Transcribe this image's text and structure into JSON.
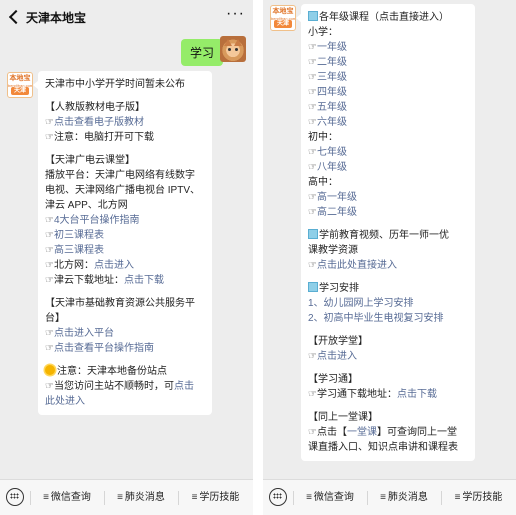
{
  "header": {
    "title": "天津本地宝",
    "more_icon": "more-dots-icon"
  },
  "left_chat": {
    "user_message": "学习",
    "bot_logo": {
      "top": "本地宝",
      "middle": "bendibao.com",
      "bottom": "天津"
    },
    "lines": [
      {
        "text": "天津市中小学开学时间暂未公布",
        "kind": "text"
      },
      {
        "text": "",
        "kind": "gap"
      },
      {
        "text": "【人教版教材电子版】",
        "kind": "text"
      },
      {
        "prefix": "☞",
        "text": "点击查看电子版教材",
        "kind": "link"
      },
      {
        "prefix": "☞",
        "text": "注意：电脑打开可下载",
        "kind": "text"
      },
      {
        "text": "",
        "kind": "gap"
      },
      {
        "text": "【天津广电云课堂】",
        "kind": "text"
      },
      {
        "text": "播放平台：天津广电网络有线数字",
        "kind": "text"
      },
      {
        "text": "电视、天津网络广播电视台 IPTV、",
        "kind": "text"
      },
      {
        "text": "津云 APP、北方网",
        "kind": "text"
      },
      {
        "prefix": "☞",
        "text": "4大台平台操作指南",
        "kind": "link"
      },
      {
        "prefix": "☞",
        "text": "初三课程表",
        "kind": "link"
      },
      {
        "prefix": "☞",
        "text": "高三课程表",
        "kind": "link"
      },
      {
        "prefix": "☞",
        "label": "北方网：",
        "text": "点击进入",
        "kind": "mixed"
      },
      {
        "prefix": "☞",
        "label": "津云下载地址：",
        "text": "点击下载",
        "kind": "mixed"
      },
      {
        "text": "",
        "kind": "gap"
      },
      {
        "text": "【天津市基础教育资源公共服务平",
        "kind": "text"
      },
      {
        "text": "台】",
        "kind": "text"
      },
      {
        "prefix": "☞",
        "text": "点击进入平台",
        "kind": "link"
      },
      {
        "prefix": "☞",
        "text": "点击查看平台操作指南",
        "kind": "link"
      },
      {
        "text": "",
        "kind": "gap"
      },
      {
        "icon": "sun",
        "text": "注意：天津本地备份站点",
        "kind": "text"
      },
      {
        "prefix": "☞",
        "label": "当您访问主站不顺畅时，可",
        "text": "点击",
        "kind": "mixed"
      },
      {
        "text": "此处进入",
        "kind": "link"
      }
    ]
  },
  "right_chat": {
    "bot_logo": {
      "top": "本地宝",
      "middle": "bendibao.com",
      "bottom": "天津"
    },
    "lines": [
      {
        "icon": "square",
        "text": "各年级课程（点击直接进入）",
        "kind": "text"
      },
      {
        "text": "小学：",
        "kind": "text"
      },
      {
        "prefix": "☞",
        "text": "一年级",
        "kind": "link"
      },
      {
        "prefix": "☞",
        "text": "二年级",
        "kind": "link"
      },
      {
        "prefix": "☞",
        "text": "三年级",
        "kind": "link"
      },
      {
        "prefix": "☞",
        "text": "四年级",
        "kind": "link"
      },
      {
        "prefix": "☞",
        "text": "五年级",
        "kind": "link"
      },
      {
        "prefix": "☞",
        "text": "六年级",
        "kind": "link"
      },
      {
        "text": "初中：",
        "kind": "text"
      },
      {
        "prefix": "☞",
        "text": "七年级",
        "kind": "link"
      },
      {
        "prefix": "☞",
        "text": "八年级",
        "kind": "link"
      },
      {
        "text": "高中：",
        "kind": "text"
      },
      {
        "prefix": "☞",
        "text": "高一年级",
        "kind": "link"
      },
      {
        "prefix": "☞",
        "text": "高二年级",
        "kind": "link"
      },
      {
        "text": "",
        "kind": "gap"
      },
      {
        "icon": "square",
        "text": "学前教育视频、历年一师一优",
        "kind": "text"
      },
      {
        "text": "课教学资源",
        "kind": "text"
      },
      {
        "prefix": "☞",
        "text": "点击此处直接进入",
        "kind": "link"
      },
      {
        "text": "",
        "kind": "gap"
      },
      {
        "icon": "square",
        "text": "学习安排",
        "kind": "text"
      },
      {
        "text": "1、幼儿园网上学习安排",
        "kind": "link"
      },
      {
        "text": "2、初高中毕业生电视复习安排",
        "kind": "link"
      },
      {
        "text": "",
        "kind": "gap"
      },
      {
        "text": "【开放学堂】",
        "kind": "text"
      },
      {
        "prefix": "☞",
        "text": "点击进入",
        "kind": "link"
      },
      {
        "text": "",
        "kind": "gap"
      },
      {
        "text": "【学习通】",
        "kind": "text"
      },
      {
        "prefix": "☞",
        "label": "学习通下载地址：",
        "text": "点击下载",
        "kind": "mixed"
      },
      {
        "text": "",
        "kind": "gap"
      },
      {
        "text": "【同上一堂课】",
        "kind": "text"
      },
      {
        "prefix": "☞",
        "label": "点击【",
        "text": "一堂课",
        "suffix": "】可查询同上一堂",
        "kind": "mixed3"
      },
      {
        "text": "课直播入口、知识点串讲和课程表",
        "kind": "text"
      }
    ]
  },
  "bottom_menu": {
    "keyboard_icon": "keyboard-icon",
    "items": [
      {
        "label": "微信查询"
      },
      {
        "label": "肺炎消息"
      },
      {
        "label": "学历技能"
      }
    ]
  }
}
